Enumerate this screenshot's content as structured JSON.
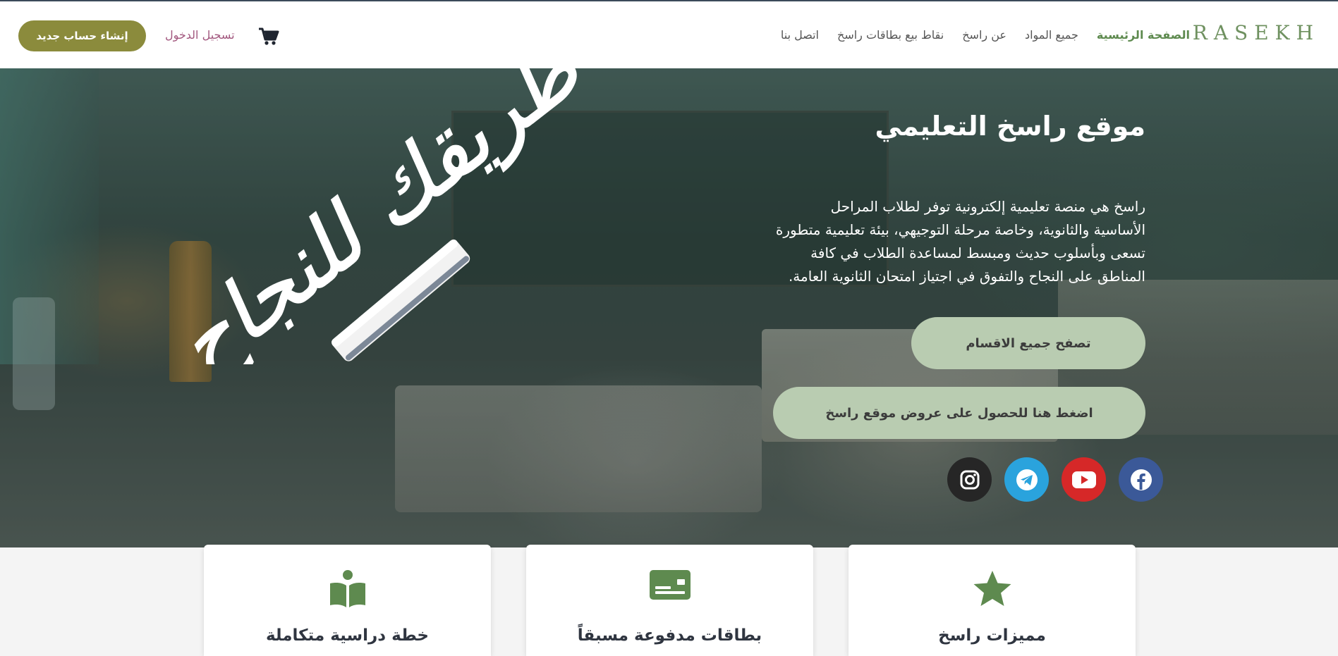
{
  "header": {
    "logo": "RASEKH",
    "nav": [
      {
        "label": "الصفحة الرئيسية",
        "active": true
      },
      {
        "label": "جميع المواد",
        "active": false
      },
      {
        "label": "عن راسخ",
        "active": false
      },
      {
        "label": "نقاط بيع بطاقات راسخ",
        "active": false
      },
      {
        "label": "اتصل بنا",
        "active": false
      }
    ],
    "login_label": "تسجيل الدخول",
    "signup_label": "إنشاء حساب جديد",
    "cart_icon": "shopping-cart-icon"
  },
  "hero": {
    "script_text": "طريقك للنجاح",
    "title": "موقع راسخ التعليمي",
    "description_lines": [
      "راسخ هي منصة تعليمية إلكترونية توفر لطلاب المراحل",
      "الأساسية والثانوية، وخاصة مرحلة التوجيهي، بيئة تعليمية متطورة",
      "تسعى وبأسلوب حديث ومبسط لمساعدة الطلاب في كافة",
      "المناطق على النجاح والتفوق في اجتياز امتحان الثانوية العامة."
    ],
    "browse_button": "تصفح جميع الاقسام",
    "offers_button": "اضغط هنا للحصول على عروض موقع راسخ",
    "social": [
      {
        "name": "facebook-icon",
        "color": "#3b5998"
      },
      {
        "name": "youtube-icon",
        "color": "#d62828"
      },
      {
        "name": "telegram-icon",
        "color": "#2aa3dd"
      },
      {
        "name": "instagram-icon",
        "color": "#262626"
      }
    ]
  },
  "features": [
    {
      "title": "مميزات راسخ",
      "icon": "star-icon"
    },
    {
      "title": "بطاقات مدفوعة مسبقاً",
      "icon": "id-card-icon"
    },
    {
      "title": "خطة دراسية متكاملة",
      "icon": "open-book-icon"
    }
  ],
  "colors": {
    "brand_green": "#6f9160",
    "button_olive": "#8b8b3c",
    "hero_button": "#b9ccb1",
    "login_text": "#a2577e"
  }
}
